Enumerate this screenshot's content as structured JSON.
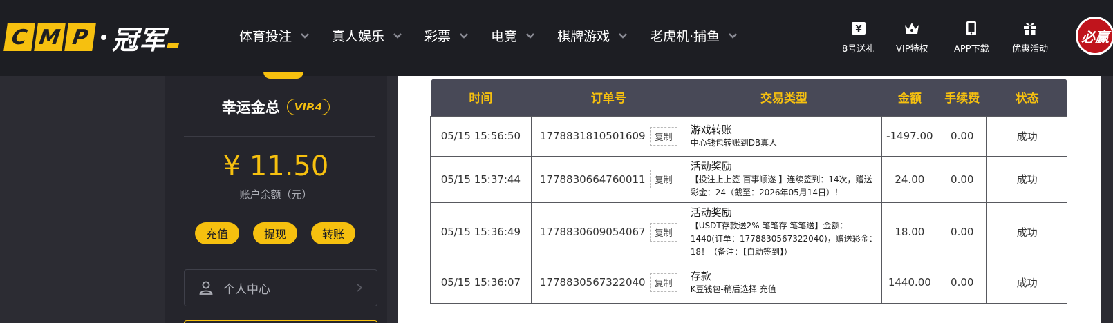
{
  "brand": {
    "letters": [
      "C",
      "M",
      "P"
    ],
    "name_cn": "冠军"
  },
  "nav": [
    {
      "label": "体育投注"
    },
    {
      "label": "真人娱乐"
    },
    {
      "label": "彩票"
    },
    {
      "label": "电竞"
    },
    {
      "label": "棋牌游戏"
    },
    {
      "label": "老虎机·捕鱼"
    }
  ],
  "quick_links": [
    {
      "label": "8号送礼",
      "icon": "gift-card-icon"
    },
    {
      "label": "VIP特权",
      "icon": "crown-icon"
    },
    {
      "label": "APP下载",
      "icon": "tablet-icon"
    },
    {
      "label": "优惠活动",
      "icon": "gift-box-icon"
    }
  ],
  "top_badge": "必赢",
  "colors": {
    "accent": "#f6c00f",
    "topbar": "#1d1e23",
    "sidebar": "#25252c",
    "table_header": "#484957",
    "success": "#2f9a2f"
  },
  "user": {
    "name": "幸运金总",
    "vip": "VIP.4",
    "balance": "¥ 11.50",
    "balance_label": "账户余额（元）"
  },
  "actions": {
    "deposit": "充值",
    "withdraw": "提现",
    "transfer": "转账"
  },
  "personal_center": "个人中心",
  "table": {
    "headers": [
      "时间",
      "订单号",
      "交易类型",
      "金额",
      "手续费",
      "状态"
    ],
    "copy_label": "复制",
    "rows": [
      {
        "time": "05/15 15:56:50",
        "order": "1778831810501609",
        "type_title": "游戏转账",
        "type_desc": "中心钱包转账到DB真人",
        "amount": "-1497.00",
        "fee": "0.00",
        "status": "成功"
      },
      {
        "time": "05/15 15:37:44",
        "order": "1778830664760011",
        "type_title": "活动奖励",
        "type_desc": "【投注上上签 百事顺遂 】连续签到：14次，赠送彩金：24（截至：2026年05月14日）！",
        "amount": "24.00",
        "fee": "0.00",
        "status": "成功"
      },
      {
        "time": "05/15 15:36:49",
        "order": "1778830609054067",
        "type_title": "活动奖励",
        "type_desc": "【USDT存款送2% 笔笔存 笔笔送】金额：1440(订单：1778830567322040)，赠送彩金：18！（备注：【自助签到】）",
        "amount": "18.00",
        "fee": "0.00",
        "status": "成功"
      },
      {
        "time": "05/15 15:36:07",
        "order": "1778830567322040",
        "type_title": "存款",
        "type_desc": "K豆钱包-稍后选择 充值",
        "amount": "1440.00",
        "fee": "0.00",
        "status": "成功"
      }
    ]
  }
}
